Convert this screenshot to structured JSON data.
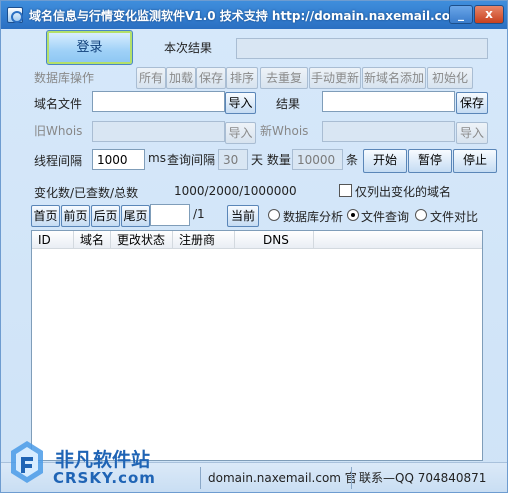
{
  "window": {
    "title": "域名信息与行情变化监测软件V1.0 技术支持 http://domain.naxemail.com",
    "min_label": "_",
    "close_label": "x"
  },
  "top": {
    "login_label": "登录",
    "result_label": "本次结果",
    "result_value": ""
  },
  "db_ops": {
    "label": "数据库操作",
    "buttons": [
      "所有",
      "加载",
      "保存",
      "排序",
      "去重复",
      "手动更新",
      "新域名添加",
      "初始化"
    ]
  },
  "files": {
    "domain_file_label": "域名文件",
    "domain_file_value": "",
    "import_label": "导入",
    "result_label": "结果",
    "result_value": "",
    "save_label": "保存",
    "old_whois_label": "旧Whois",
    "old_whois_value": "",
    "old_import_label": "导入",
    "new_whois_label": "新Whois",
    "new_whois_value": "",
    "new_import_label": "导入"
  },
  "threads": {
    "label": "线程间隔",
    "value": "1000",
    "ms_label": "ms",
    "query_label": "查询间隔",
    "query_value": "30",
    "days_label": "天 数量",
    "count_value": "10000",
    "unit_label": "条",
    "start_label": "开始",
    "pause_label": "暂停",
    "stop_label": "停止"
  },
  "stats": {
    "label": "变化数/已查数/总数",
    "value": "1000/2000/1000000",
    "only_changed_label": "仅列出变化的域名",
    "only_changed_checked": false
  },
  "paging": {
    "first": "首页",
    "prev": "前页",
    "next": "后页",
    "last": "尾页",
    "page_value": "",
    "page_total": "/1",
    "current": "当前",
    "modes": [
      {
        "label": "数据库分析",
        "selected": false
      },
      {
        "label": "文件查询",
        "selected": true
      },
      {
        "label": "文件对比",
        "selected": false
      }
    ]
  },
  "table": {
    "columns": [
      "ID",
      "域名",
      "更改状态",
      "注册商",
      "DNS"
    ],
    "rows": []
  },
  "statusbar": {
    "cell1": "",
    "cell2": "domain.naxemail.com 官",
    "cell3": "联系—QQ 704840871"
  },
  "watermark": {
    "top": "非凡软件站",
    "bottom": "CRSKY.com"
  },
  "colors": {
    "title_bar": "#2a6fc2",
    "panel": "#d6e8fa",
    "accent": "#1f64b5"
  }
}
